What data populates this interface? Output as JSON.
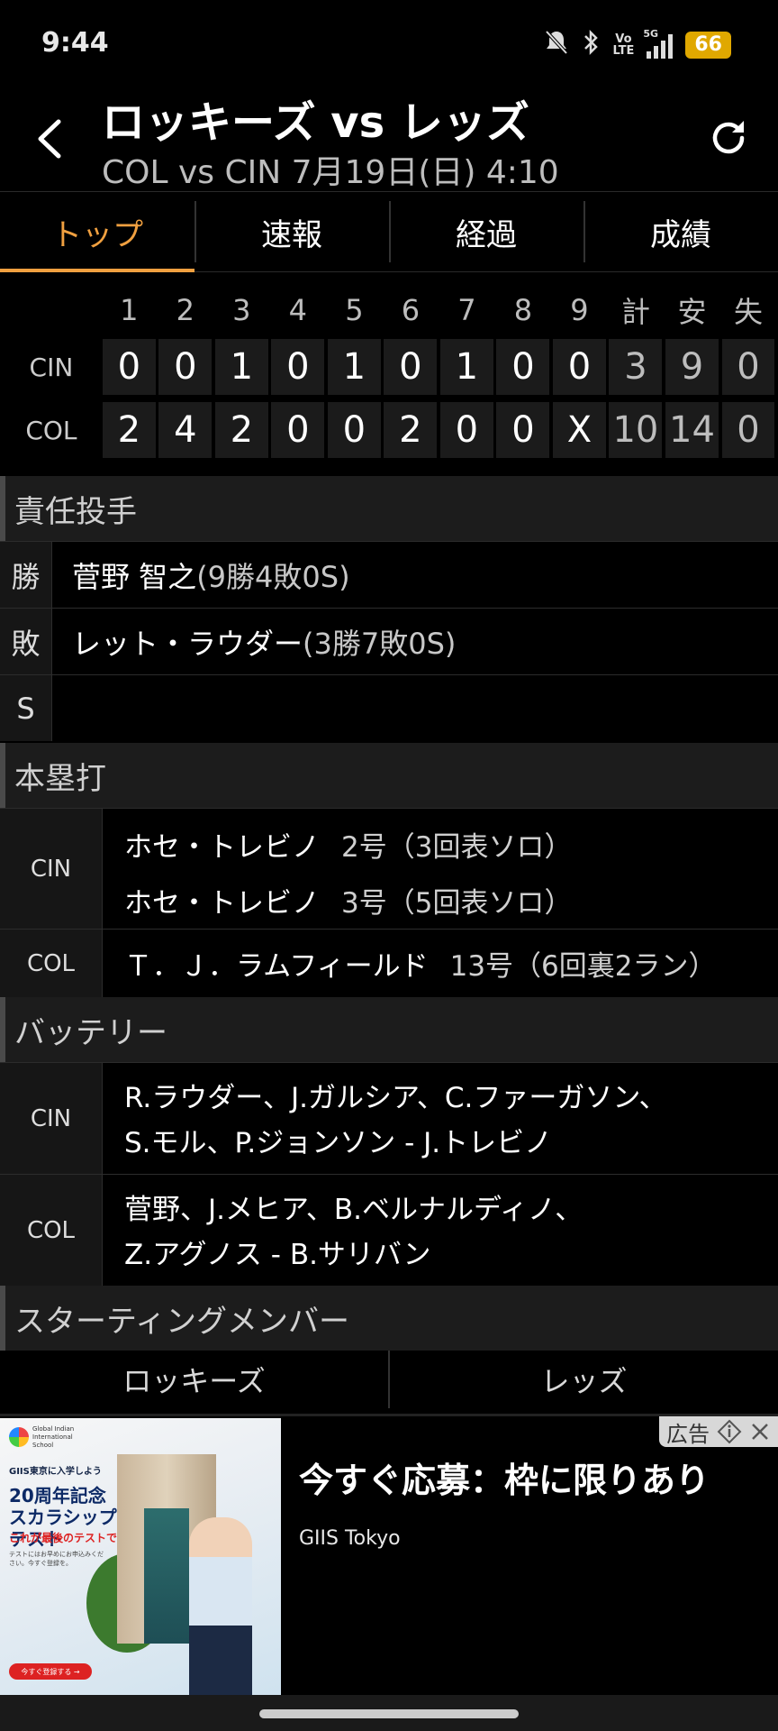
{
  "status_bar": {
    "time": "9:44",
    "network": "5G",
    "volte_top": "Vo",
    "volte_bottom": "LTE",
    "battery": "66",
    "icons": [
      "mute-bell-icon",
      "bluetooth-icon",
      "volte-icon",
      "signal-icon",
      "battery-icon"
    ]
  },
  "header": {
    "title": "ロッキーズ vs レッズ",
    "subtitle": "COL vs CIN 7月19日(日) 4:10"
  },
  "tabs": [
    {
      "label": "トップ",
      "active": true
    },
    {
      "label": "速報",
      "active": false
    },
    {
      "label": "経過",
      "active": false
    },
    {
      "label": "成績",
      "active": false
    }
  ],
  "scoreboard": {
    "columns": [
      "1",
      "2",
      "3",
      "4",
      "5",
      "6",
      "7",
      "8",
      "9",
      "計",
      "安",
      "失"
    ],
    "rows": [
      {
        "team": "CIN",
        "cells": [
          "0",
          "0",
          "1",
          "0",
          "1",
          "0",
          "1",
          "0",
          "0",
          "3",
          "9",
          "0"
        ]
      },
      {
        "team": "COL",
        "cells": [
          "2",
          "4",
          "2",
          "0",
          "0",
          "2",
          "0",
          "0",
          "X",
          "10",
          "14",
          "0"
        ]
      }
    ]
  },
  "pitchers": {
    "heading": "責任投手",
    "win_label": "勝",
    "win_name": "菅野 智之",
    "win_record": "(9勝4敗0S)",
    "loss_label": "敗",
    "loss_name": "レット・ラウダー",
    "loss_record": "(3勝7敗0S)",
    "save_label": "S",
    "save_name": ""
  },
  "homeruns": {
    "heading": "本塁打",
    "cin_team": "CIN",
    "cin_hr": [
      {
        "player": "ホセ・トレビノ",
        "detail": "2号（3回表ソロ）"
      },
      {
        "player": "ホセ・トレビノ",
        "detail": "3号（5回表ソロ）"
      }
    ],
    "col_team": "COL",
    "col_hr": [
      {
        "player": "Ｔ．Ｊ．ラムフィールド",
        "detail": "13号（6回裏2ラン）"
      }
    ]
  },
  "battery": {
    "heading": "バッテリー",
    "cin_team": "CIN",
    "cin_line1": "R.ラウダー、J.ガルシア、C.ファーガソン、",
    "cin_line2": "S.モル、P.ジョンソン - J.トレビノ",
    "col_team": "COL",
    "col_line1": "菅野、J.メヒア、B.ベルナルディノ、",
    "col_line2": "Z.アグノス - B.サリバン"
  },
  "starting": {
    "heading": "スターティングメンバー",
    "tab_home": "ロッキーズ",
    "tab_away": "レッズ"
  },
  "ad": {
    "badge": "広告",
    "headline": "今すぐ応募：枠に限りあり",
    "advertiser": "GIIS Tokyo",
    "image_logo_text": "Global Indian International School",
    "image_line1": "GIIS東京に入学しよう",
    "image_title": "20周年記念スカラシップテスト",
    "image_red": "これが最後のテストです。",
    "image_small": "テストにはお早めにお申込みください。今すぐ登録を。",
    "image_button": "今すぐ登録する →"
  }
}
